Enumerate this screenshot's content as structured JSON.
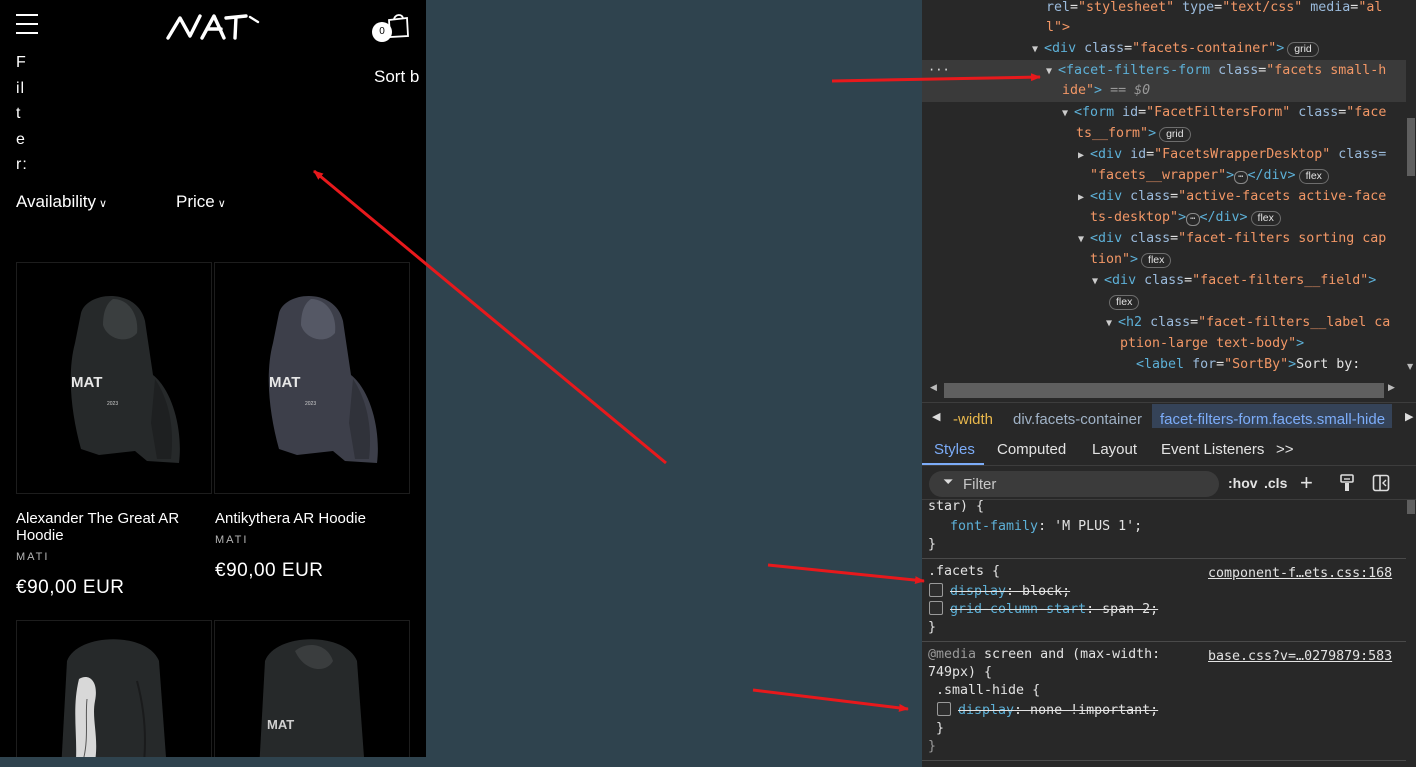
{
  "site": {
    "cart_count": "0",
    "filter_label": "Filter:",
    "sort_label": "Sort b",
    "facets": [
      "Availability",
      "Price"
    ],
    "chevron": "∨",
    "products": [
      {
        "title_line1": "Alexander The Great AR",
        "title_line2": "Hoodie",
        "vendor": "MATI",
        "price": "€90,00 EUR"
      },
      {
        "title_line1": "Antikythera AR Hoodie",
        "title_line2": "",
        "vendor": "MATI",
        "price": "€90,00 EUR"
      }
    ],
    "icons": [
      "hamburger-icon",
      "logo",
      "cart-icon"
    ]
  },
  "devtools": {
    "dom": {
      "l1": {
        "a1": "rel",
        "v1": "\"stylesheet\"",
        "a2": "type",
        "v2": "\"text/css\"",
        "a3": "media",
        "v3": "\"al"
      },
      "l2": "l\">",
      "l3": {
        "tag": "<div",
        "a": "class",
        "v": "\"facets-container\"",
        "close": ">",
        "badge": "grid"
      },
      "l4": {
        "tag": "<facet-filters-form",
        "a": "class",
        "v": "\"facets small-h"
      },
      "l5": {
        "v": "ide\"",
        "close": ">",
        "eq": "== $0"
      },
      "l6": {
        "tag": "<form",
        "a1": "id",
        "v1": "\"FacetFiltersForm\"",
        "a2": "class",
        "v2": "\"face"
      },
      "l7": {
        "v": "ts__form\"",
        "close": ">",
        "badge": "grid"
      },
      "l8": {
        "tag": "<div",
        "a1": "id",
        "v1": "\"FacetsWrapperDesktop\"",
        "a2": "class="
      },
      "l9": {
        "v": "\"facets__wrapper\"",
        "close": ">",
        "dots": "⋯",
        "end": "</div>",
        "badge": "flex"
      },
      "l10": {
        "tag": "<div",
        "a": "class",
        "v": "\"active-facets active-face"
      },
      "l11": {
        "v": "ts-desktop\"",
        "close": ">",
        "dots": "⋯",
        "end": "</div>",
        "badge": "flex"
      },
      "l12": {
        "tag": "<div",
        "a": "class",
        "v": "\"facet-filters sorting cap"
      },
      "l13": {
        "v": "tion\"",
        "close": ">",
        "badge": "flex"
      },
      "l14": {
        "tag": "<div",
        "a": "class",
        "v": "\"facet-filters__field\"",
        "close": ">"
      },
      "l15": {
        "badge": "flex"
      },
      "l16": {
        "tag": "<h2",
        "a": "class",
        "v": "\"facet-filters__label ca"
      },
      "l17": {
        "v": "ption-large text-body\"",
        "close": ">"
      },
      "l18": {
        "tag": "<label",
        "a": "for",
        "v": "\"SortBy\"",
        "close": ">",
        "text": "Sort by:"
      },
      "row_dots": "···"
    },
    "breadcrumbs": [
      "-width",
      "div.facets-container",
      "facet-filters-form.facets.small-hide"
    ],
    "tabs": [
      "Styles",
      "Computed",
      "Layout",
      "Event Listeners",
      ">>"
    ],
    "filter_placeholder": "Filter",
    "toolbar": {
      "hov": ":hov",
      "cls": ".cls",
      "plus": "+"
    },
    "styles": {
      "r0_sel": "star) {",
      "r0_prop": "font-family",
      "r0_val": ": 'M PLUS 1';",
      "close": "}",
      "r1_sel": ".facets {",
      "r1_src": "component-f…ets.css:168",
      "r1_p1": "display",
      "r1_v1": ": block;",
      "r1_p2": "grid-column-start",
      "r1_v2": ": span 2;",
      "r2_media": "@media",
      "r2_query": " screen and (max-width:",
      "r2_query2": "749px) {",
      "r2_src": "base.css?v=…0279879:583",
      "r2_sel": ".small-hide {",
      "r2_p1": "display",
      "r2_v1": ": none !important;"
    }
  },
  "colors": {
    "page_bg": "#2f434e",
    "site_bg": "#000000",
    "devtools_bg": "#282828",
    "tag": "#5db0d7",
    "attr_value": "#f29766",
    "accent": "#7cacf8",
    "arrow": "#e8191c"
  }
}
